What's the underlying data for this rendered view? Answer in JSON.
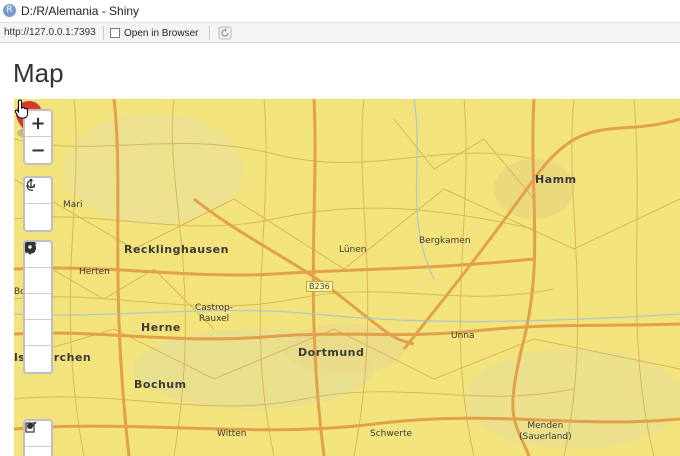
{
  "window": {
    "title": "D:/R/Alemania - Shiny"
  },
  "toolbar": {
    "url": "http://127.0.0.1:7393",
    "open_browser_label": "Open in Browser"
  },
  "page": {
    "title": "Map"
  },
  "map": {
    "cities": [
      {
        "name": "Hamm"
      },
      {
        "name": "Mari"
      },
      {
        "name": "Recklinghausen"
      },
      {
        "name": "Lünen"
      },
      {
        "name": "Bergkamen"
      },
      {
        "name": "Herten"
      },
      {
        "name": "Castrop-\nRauxel"
      },
      {
        "name": "Herne"
      },
      {
        "name": "Dortmund"
      },
      {
        "name": "Unna"
      },
      {
        "name": "lsenkirchen"
      },
      {
        "name": "Bochum"
      },
      {
        "name": "Witten"
      },
      {
        "name": "Schwerte"
      },
      {
        "name": "Menden\n(Sauerland)"
      },
      {
        "name": "Bo"
      }
    ],
    "road_label": "B236",
    "marker_icon": "airplane-icon",
    "colors": {
      "land": "#f3e37c",
      "major_road": "#e2a04a",
      "minor_road": "#d8b25a",
      "marker": "#d23a2c",
      "forest": "#dfe0a0"
    }
  },
  "controls": {
    "zoom": [
      {
        "label": "+",
        "name": "zoom-in-button"
      },
      {
        "label": "−",
        "name": "zoom-out-button"
      }
    ],
    "tools_a": [
      {
        "icon": "accessibility-icon"
      },
      {
        "icon": "refresh-icon"
      }
    ],
    "draw": [
      {
        "icon": "draw-polyline-icon"
      },
      {
        "icon": "draw-polygon-icon"
      },
      {
        "icon": "draw-rectangle-icon"
      },
      {
        "icon": "draw-marker-icon"
      },
      {
        "icon": "draw-circle-icon"
      }
    ],
    "edit": [
      {
        "icon": "edit-layers-icon"
      }
    ]
  }
}
